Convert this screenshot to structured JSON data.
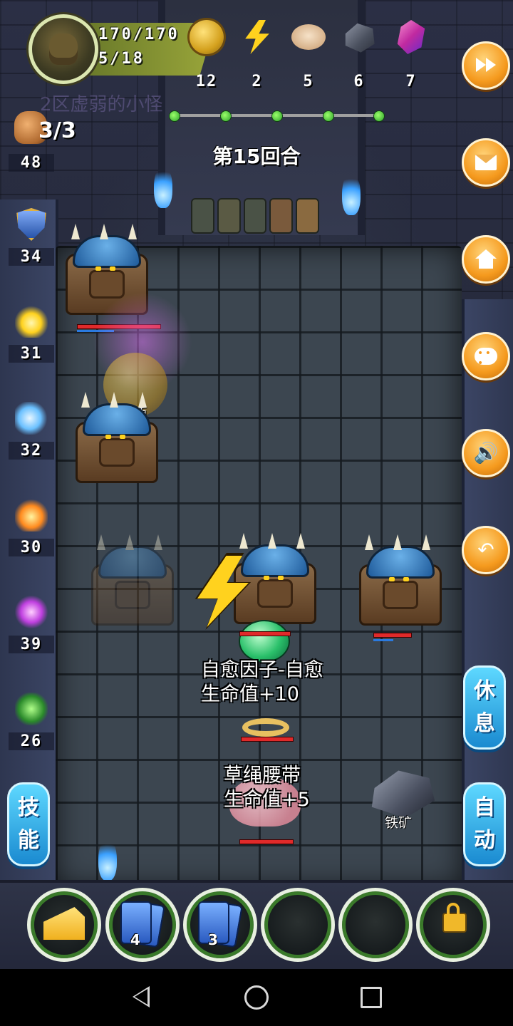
{
  "player": {
    "hp": "170/170",
    "level": "5/18"
  },
  "resources": [
    {
      "icon": "gold-coin-icon",
      "count": "12"
    },
    {
      "icon": "lightning-icon",
      "count": "2"
    },
    {
      "icon": "bun-icon",
      "count": "5"
    },
    {
      "icon": "iron-ore-icon",
      "count": "6"
    },
    {
      "icon": "crystal-icon",
      "count": "7"
    }
  ],
  "ghost_text": "2区虚弱的小怪",
  "round": "第15回合",
  "attack": {
    "count": "3/3",
    "value": "48"
  },
  "stats": [
    {
      "icon": "shield-icon",
      "value": "34"
    },
    {
      "icon": "holy-icon",
      "value": "31"
    },
    {
      "icon": "water-icon",
      "value": "32"
    },
    {
      "icon": "fire-icon",
      "value": "30"
    },
    {
      "icon": "thunder-icon",
      "value": "39"
    },
    {
      "icon": "poison-icon",
      "value": "26"
    }
  ],
  "right_buttons": [
    {
      "name": "fast-forward",
      "icon": "fast-forward-icon"
    },
    {
      "name": "mail",
      "icon": "envelope-icon"
    },
    {
      "name": "home",
      "icon": "home-icon"
    },
    {
      "name": "chat",
      "icon": "chat-bubble-icon"
    },
    {
      "name": "sound",
      "icon": "speaker-icon"
    },
    {
      "name": "back",
      "icon": "return-arrow-icon"
    }
  ],
  "buttons": {
    "skill": "技能",
    "rest": "休息",
    "auto": "自动"
  },
  "field": {
    "magic_label": "魔法币",
    "effect1_line1": "自愈因子-自愈",
    "effect1_line2": "生命值+10",
    "effect2_line1": "草绳腰带",
    "effect2_line2": "生命值+5",
    "ore_label": "铁矿"
  },
  "slots": [
    {
      "item": "cheese-icon",
      "count": ""
    },
    {
      "item": "card-icon",
      "count": "4"
    },
    {
      "item": "card-icon",
      "count": "3"
    },
    {
      "item": "empty",
      "count": ""
    },
    {
      "item": "empty",
      "count": ""
    },
    {
      "item": "lock-icon",
      "count": ""
    }
  ],
  "colors": {
    "accent_orange": "#f59a1e",
    "accent_blue": "#1a8ad0",
    "slot_ring": "#3a7a2a"
  }
}
